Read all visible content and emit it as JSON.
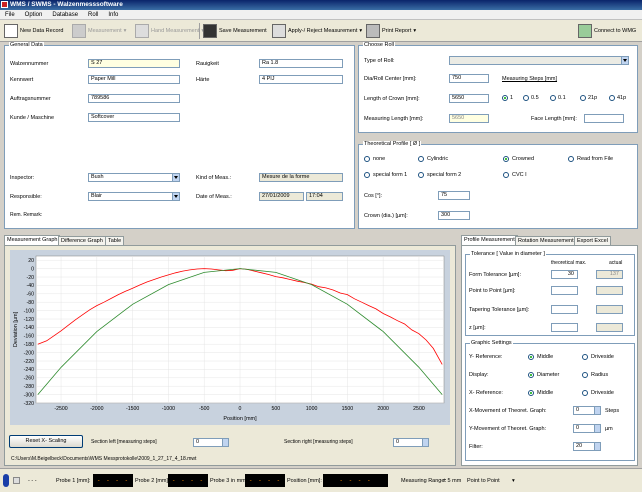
{
  "window": {
    "title": "WMS / SWMS - Walzenmesssoftware"
  },
  "menu": [
    "File",
    "Option",
    "Database",
    "Roll",
    "Info"
  ],
  "toolbar": {
    "new_record": "New Data Record",
    "measurement": "Measurement",
    "hand_measurement": "Hand Measurement",
    "save": "Save Measurement",
    "apply": "Apply-/ Reject Measurement",
    "print": "Print Report",
    "connect": "Connect to WMG"
  },
  "general": {
    "title": "General Data",
    "walzennummer_label": "Walzennummer",
    "walzennummer": "S 27",
    "kennwert_label": "Kennwert",
    "kennwert": "Paper Mill",
    "auftrag_label": "Auftragsnummer",
    "auftrag": "789586",
    "kunde_label": "Kunde / Maschine",
    "kunde": "Softcover",
    "rauigkeit_label": "Rauigkeit",
    "rauigkeit": "Ra 1.8",
    "haerte_label": "Härte",
    "haerte": "4 PIJ",
    "inspector_label": "Inspector:",
    "inspector": "Bush",
    "responsible_label": "Responsible:",
    "responsible": "Blair",
    "kind_label": "Kind of Meas.:",
    "kind": "Mesure de la forme",
    "date_label": "Date of Meas.:",
    "date": "27/01/2009",
    "time": "17:04",
    "remark_label": "Rem. Remark:"
  },
  "choose": {
    "title": "Choose Roll",
    "type_label": "Type of Roll:",
    "dia_label": "Dia/Roll Center [mm]:",
    "dia": "750",
    "steps_label": "Measuring Steps [mm]",
    "crown_label": "Length of Crown [mm]:",
    "crown": "5650",
    "steps": [
      "1",
      "0.5",
      "0.1",
      "21p",
      "41p"
    ],
    "meas_label": "Measuring Length [mm]:",
    "meas": "5650",
    "face_label": "Face Length [mm]:"
  },
  "profile": {
    "title": "Theoretical Profile [ Ø ]",
    "opts": [
      "none",
      "Cylindric",
      "Crowned",
      "Read from File",
      "special form 1",
      "special form 2",
      "CVC I"
    ],
    "cos_label": "Cos [°]:",
    "cos": "75",
    "crowndia_label": "Crown (dia.) [µm]:",
    "crowndia": "300"
  },
  "graph_tabs": [
    "Measurement Graph",
    "Difference Graph",
    "Table"
  ],
  "right_tabs": [
    "Profile Measurement",
    "Rotation Measurement",
    "Export Excel"
  ],
  "tolerance": {
    "title": "Tolerance [ Value in diameter ]",
    "col_theo": "theoretical max.",
    "col_actual": "actual",
    "form_label": "Form Tolerance [µm]:",
    "form_theo": "30",
    "form_actual": "137",
    "ptp_label": "Point to Point [µm]:",
    "taper_label": "Tapering Tolerance [µm]:",
    "z_label": "z [µm]:"
  },
  "graphic": {
    "title": "Graphic Settings",
    "yref_label": "Y- Reference:",
    "yref_a": "Middle",
    "yref_b": "Driveside",
    "disp_label": "Display:",
    "disp_a": "Diameter",
    "disp_b": "Radius",
    "xref_label": "X- Reference:",
    "xref_a": "Middle",
    "xref_b": "Driveside",
    "xmove_label": "X-Movement of Theoret. Graph:",
    "xmove": "0",
    "xmove_unit": "Steps",
    "ymove_label": "Y-Movement of Theoret. Graph:",
    "ymove": "0",
    "ymove_unit": "µm",
    "filter_label": "Filter:",
    "filter": "20"
  },
  "bottom": {
    "reset": "Reset X- Scaling",
    "sec_left": "Section left [measuring steps]",
    "sec_left_val": "0",
    "sec_right": "Section right [measuring steps]",
    "sec_right_val": "0",
    "path": "C:\\Users\\M.Beigelbeck\\Documents\\WMS Messprotokolle\\2009_1_27_17_4_18.mwt"
  },
  "status": {
    "dashes": "- - -",
    "probe1": "Probe 1 [mm]:",
    "probe2": "Probe 2 [mm]:",
    "probe3": "Probe 3 in mm:",
    "position": "Position [mm]:",
    "led": "- - - -",
    "range_label": "Measuring Range:",
    "range": "± 5 mm",
    "mode": "Point to Point"
  },
  "chart_data": {
    "type": "line",
    "xlabel": "Position [mm]",
    "ylabel": "Deviation [µm]",
    "xlim": [
      -2850,
      2850
    ],
    "ylim": [
      -320,
      30
    ],
    "xticks": [
      -2500,
      -2000,
      -1500,
      -1000,
      -500,
      0,
      500,
      1000,
      1500,
      2000,
      2500
    ],
    "yticks": [
      20,
      0,
      -20,
      -40,
      -60,
      -80,
      -100,
      -120,
      -140,
      -160,
      -180,
      -200,
      -220,
      -240,
      -260,
      -280,
      -300,
      -320
    ],
    "series": [
      {
        "color": "#ff0000",
        "x": [
          -2825,
          -2700,
          -2600,
          -2500,
          -2400,
          -2300,
          -2200,
          -2100,
          -2000,
          -1900,
          -1800,
          -1700,
          -1600,
          -1500,
          -1400,
          -1300,
          -1200,
          -1100,
          -1000,
          -900,
          -800,
          -700,
          -600,
          -500,
          -400,
          -300,
          -200,
          -100,
          0,
          100,
          200,
          300,
          400,
          500,
          600,
          700,
          800,
          900,
          1000,
          1100,
          1200,
          1300,
          1400,
          1500,
          1600,
          1700,
          1800,
          1900,
          2000,
          2100,
          2200,
          2300,
          2400,
          2500,
          2600,
          2700,
          2825
        ],
        "y": [
          -180,
          -172,
          -160,
          -148,
          -135,
          -122,
          -110,
          -98,
          -88,
          -80,
          -71,
          -62,
          -54,
          -47,
          -39,
          -32,
          -26,
          -20,
          -15,
          -10,
          -6,
          -3,
          -1,
          0,
          -1,
          -3,
          -5,
          -4,
          0,
          -2,
          -6,
          -10,
          -14,
          -19,
          -22,
          -26,
          -30,
          -33,
          -37,
          -43,
          -46,
          -51,
          -58,
          -62,
          -72,
          -80,
          -88,
          -96,
          -107,
          -115,
          -124,
          -132,
          -146,
          -155,
          -170,
          -190,
          -228
        ]
      },
      {
        "color": "#2e8b2e",
        "x": [
          -2825,
          -2500,
          -2000,
          -1500,
          -1000,
          -500,
          0,
          500,
          1000,
          1500,
          2000,
          2500,
          2825
        ],
        "y": [
          -300,
          -235,
          -150,
          -85,
          -38,
          -9,
          0,
          -9,
          -38,
          -85,
          -150,
          -235,
          -300
        ]
      }
    ]
  }
}
